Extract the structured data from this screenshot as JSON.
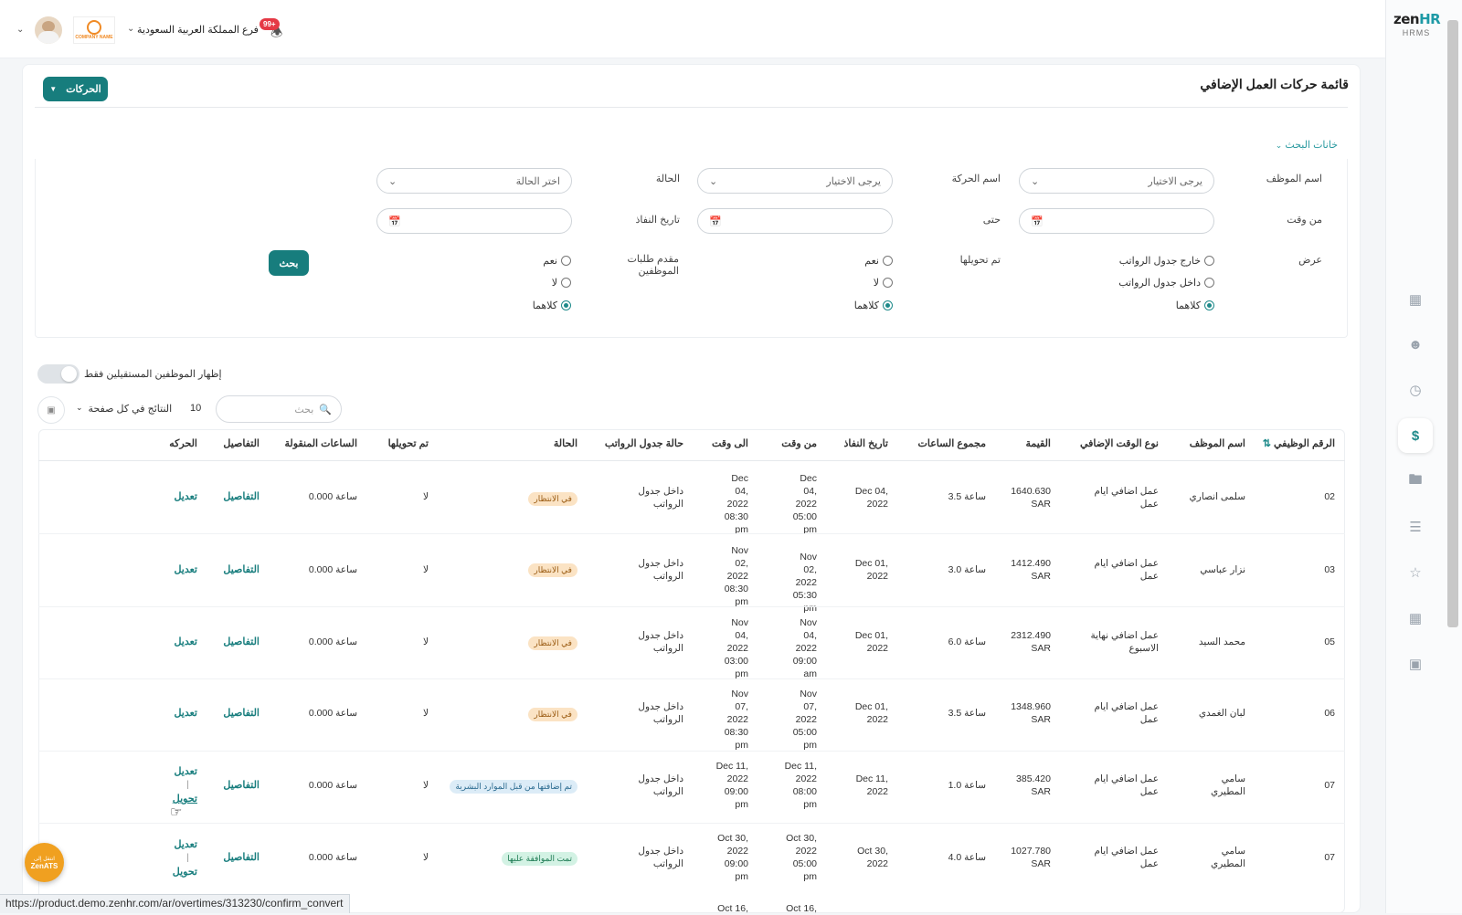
{
  "app": {
    "brand": "zen",
    "brand_accent": "HR",
    "brand_sub": "HRMS"
  },
  "topbar": {
    "branch": "فرع المملكة العربية السعودية",
    "notif_count": "99+",
    "company_logo_text": "COMPANY NAME"
  },
  "page": {
    "title": "قائمة حركات العمل الإضافي",
    "actions_button": "الحركات",
    "filters_toggle": "خانات البحث"
  },
  "filters": {
    "employee_name_label": "اسم الموظف",
    "employee_name_placeholder": "يرجى الاختيار",
    "transaction_name_label": "اسم الحركة",
    "transaction_name_placeholder": "يرجى الاختيار",
    "status_label": "الحالة",
    "status_placeholder": "اختر الحالة",
    "from_time_label": "من وقت",
    "to_label": "حتى",
    "effective_date_label": "تاريخ النفاذ",
    "view_label": "عرض",
    "view_options": [
      "خارج جدول الرواتب",
      "داخل جدول الرواتب",
      "كلاهما"
    ],
    "converted_label": "تم تحويلها",
    "converted_options": [
      "نعم",
      "لا",
      "كلاهما"
    ],
    "submitter_label": "مقدم طلبات الموظفين",
    "submitter_options": [
      "نعم",
      "لا",
      "كلاهما"
    ],
    "search_button": "بحث"
  },
  "list_controls": {
    "resigned_toggle": "إظهار الموظفين المستقيلين فقط",
    "search_placeholder": "بحث",
    "per_page_value": "10",
    "per_page_label": "النتائج في كل صفحة"
  },
  "table": {
    "headers": [
      "الرقم الوظيفي",
      "اسم الموظف",
      "نوع الوقت الإضافي",
      "القيمة",
      "مجموع الساعات",
      "تاريخ النفاذ",
      "من وقت",
      "الى وقت",
      "حالة جدول الرواتب",
      "الحالة",
      "تم تحويلها",
      "الساعات المنقولة",
      "التفاصيل",
      "الحركه"
    ],
    "rows": [
      {
        "id": "02",
        "name": "سلمى انصاري",
        "type": "عمل اضافي ايام عمل",
        "value": "1640.630 SAR",
        "hours": "3.5 ساعة",
        "effective": "Dec 04, 2022",
        "from": "Dec 04, 2022 05:00 pm",
        "to": "Dec 04, 2022 08:30 pm",
        "payroll": "داخل جدول الرواتب",
        "status": "في الانتظار",
        "converted": "لا",
        "moved": "0.000 ساعة",
        "details": "التفاصيل",
        "action1": "تعديل",
        "action2": ""
      },
      {
        "id": "03",
        "name": "نزار عباسي",
        "type": "عمل اضافي ايام عمل",
        "value": "1412.490 SAR",
        "hours": "3.0 ساعة",
        "effective": "Dec 01, 2022",
        "from": "Nov 02, 2022 05:30 pm",
        "to": "Nov 02, 2022 08:30 pm",
        "payroll": "داخل جدول الرواتب",
        "status": "في الانتظار",
        "converted": "لا",
        "moved": "0.000 ساعة",
        "details": "التفاصيل",
        "action1": "تعديل",
        "action2": ""
      },
      {
        "id": "05",
        "name": "محمد السيد",
        "type": "عمل اضافي نهاية الاسبوع",
        "value": "2312.490 SAR",
        "hours": "6.0 ساعة",
        "effective": "Dec 01, 2022",
        "from": "Nov 04, 2022 09:00 am",
        "to": "Nov 04, 2022 03:00 pm",
        "payroll": "داخل جدول الرواتب",
        "status": "في الانتظار",
        "converted": "لا",
        "moved": "0.000 ساعة",
        "details": "التفاصيل",
        "action1": "تعديل",
        "action2": ""
      },
      {
        "id": "06",
        "name": "لبان الغمدي",
        "type": "عمل اضافي ايام عمل",
        "value": "1348.960 SAR",
        "hours": "3.5 ساعة",
        "effective": "Dec 01, 2022",
        "from": "Nov 07, 2022 05:00 pm",
        "to": "Nov 07, 2022 08:30 pm",
        "payroll": "داخل جدول الرواتب",
        "status": "في الانتظار",
        "converted": "لا",
        "moved": "0.000 ساعة",
        "details": "التفاصيل",
        "action1": "تعديل",
        "action2": ""
      },
      {
        "id": "07",
        "name": "سامي المطيري",
        "type": "عمل اضافي ايام عمل",
        "value": "385.420 SAR",
        "hours": "1.0 ساعة",
        "effective": "Dec 11, 2022",
        "from": "Dec 11, 2022 08:00 pm",
        "to": "Dec 11, 2022 09:00 pm",
        "payroll": "داخل جدول الرواتب",
        "status": "تم إضافتها من قبل الموارد البشرية",
        "converted": "لا",
        "moved": "0.000 ساعة",
        "details": "التفاصيل",
        "action1": "تعديل",
        "action2": "تحويل"
      },
      {
        "id": "07",
        "name": "سامي المطيري",
        "type": "عمل اضافي ايام عمل",
        "value": "1027.780 SAR",
        "hours": "4.0 ساعة",
        "effective": "Oct 30, 2022",
        "from": "Oct 30, 2022 05:00 pm",
        "to": "Oct 30, 2022 09:00 pm",
        "payroll": "داخل جدول الرواتب",
        "status": "تمت الموافقة عليها",
        "converted": "لا",
        "moved": "0.000 ساعة",
        "details": "التفاصيل",
        "action1": "تعديل",
        "action2": "تحويل"
      }
    ],
    "partial_row": {
      "from": "Oct 16,",
      "to": "Oct 16,"
    }
  },
  "status_url": "https://product.demo.zenhr.com/ar/overtimes/313230/confirm_convert",
  "ats_badge": {
    "line1": "انتقل إلى",
    "line2": "ZenATS"
  },
  "colors": {
    "accent": "#177d7d",
    "pending_bg": "#fbe3c4",
    "approved_bg": "#d3f2e4",
    "hr_bg": "#dcecf7",
    "notif": "#e53945"
  }
}
